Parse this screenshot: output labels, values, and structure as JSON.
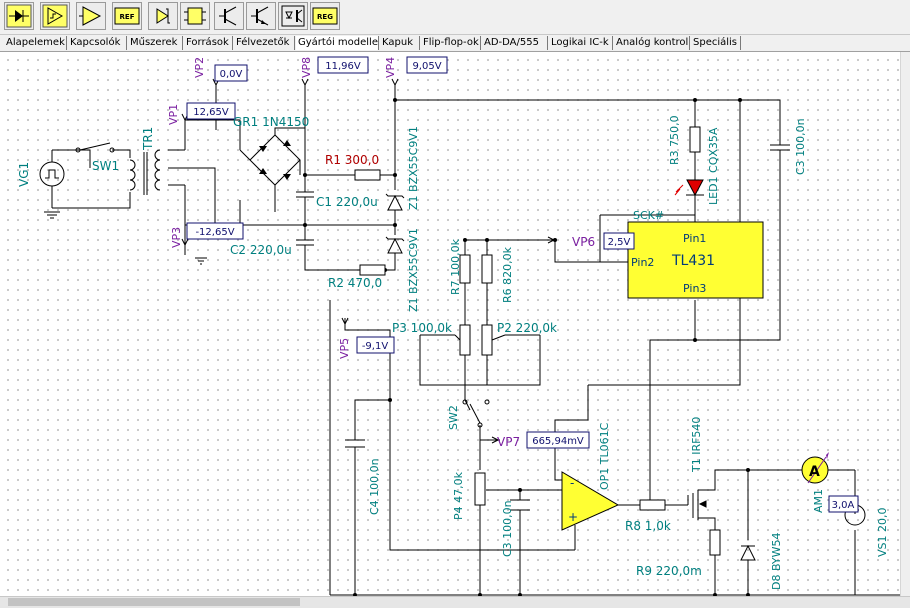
{
  "toolbar": {
    "buttons": [
      {
        "name": "diode-component-icon"
      },
      {
        "name": "schmitt-component-icon"
      },
      {
        "name": "amplifier-component-icon"
      },
      {
        "name": "reference-component-icon",
        "text": "REF"
      },
      {
        "name": "zener-component-icon"
      },
      {
        "name": "ic-component-icon"
      },
      {
        "name": "npn-transistor-icon"
      },
      {
        "name": "pnp-transistor-icon"
      },
      {
        "name": "optocoupler-icon"
      },
      {
        "name": "regulator-component-icon",
        "text": "REG"
      }
    ]
  },
  "tabs": [
    "Alapelemek",
    "Kapcsolók",
    "Műszerek",
    "Források",
    "Félvezetők",
    "Gyártói modellek",
    "Kapuk",
    "Flip-flop-ok",
    "AD-DA/555",
    "Logikai IC-k",
    "Analóg kontroll",
    "Speciális"
  ],
  "active_tab": "Gyártói modellek",
  "schematic": {
    "sources": {
      "vg1": "VG1",
      "vs1": "VS1 20,0"
    },
    "switches": {
      "sw1": "SW1",
      "sw2": "SW2"
    },
    "transformer": "TR1",
    "bridge": "GR1 1N4150",
    "resistors": {
      "r1": "R1 300,0",
      "r2": "R2 470,0",
      "r3": "R3 750,0",
      "r6": "R6 820,0k",
      "r7": "R7 100,0k",
      "r8": "R8 1,0k",
      "r9": "R9 220,0m",
      "p2": "P2 220,0k",
      "p3": "P3 100,0k",
      "p4": "P4 47,0k"
    },
    "capacitors": {
      "c1": "C1 220,0u",
      "c2": "C2 220,0u",
      "c3_top": "C3 100,0n",
      "c3_bottom": "C3 100,0n",
      "c4": "C4 100,0n"
    },
    "diodes": {
      "z1_top": "Z1 BZX55C9V1",
      "z1_bottom": "Z1 BZX55C9V1",
      "led1": "LED1 CQX35A",
      "d8": "D8 BYW54"
    },
    "ic": {
      "name": "TL431",
      "pin1": "Pin1",
      "pin2": "Pin2",
      "pin3": "Pin3",
      "sck": "SCK#"
    },
    "opamp": {
      "label": "OP1 TL061C",
      "minus": "-",
      "plus": "+"
    },
    "transistor": "T1 IRF540",
    "ammeter": {
      "name": "AM1",
      "glyph": "A",
      "reading": "3,0A"
    },
    "probes": [
      {
        "name": "VP1",
        "value": "12,65V"
      },
      {
        "name": "VP2",
        "value": "0,0V"
      },
      {
        "name": "VP3",
        "value": "-12,65V"
      },
      {
        "name": "VP4",
        "value": "9,05V"
      },
      {
        "name": "VP5",
        "value": "-9,1V"
      },
      {
        "name": "VP6",
        "value": "2,5V"
      },
      {
        "name": "VP7",
        "value": "665,94mV"
      },
      {
        "name": "VP8",
        "value": "11,96V"
      }
    ]
  },
  "colors": {
    "wire": "#000000",
    "label": "#007f7f",
    "probe": "#7a1fa0",
    "resistor_label": "#b00000",
    "ic_fill": "#ffff33",
    "led": "#e00000"
  }
}
